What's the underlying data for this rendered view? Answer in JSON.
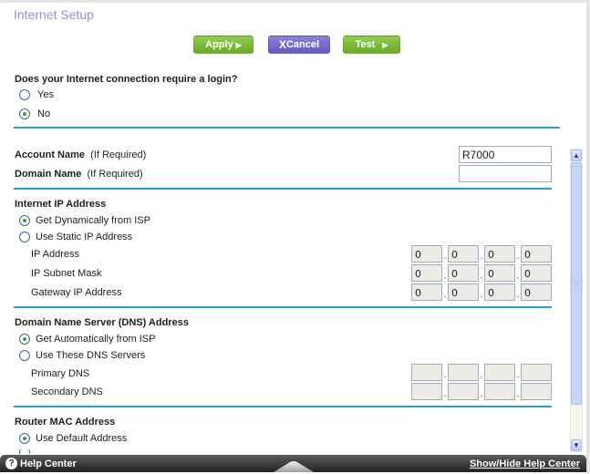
{
  "page": {
    "title": "Internet Setup"
  },
  "toolbar": {
    "apply_label": "Apply",
    "cancel_label": "Cancel",
    "test_label": "Test",
    "apply_color": "#7cbe3b",
    "cancel_color": "#7269cf"
  },
  "login": {
    "question": "Does your Internet connection require a login?",
    "options": [
      {
        "label": "Yes",
        "checked": false
      },
      {
        "label": "No",
        "checked": true
      }
    ]
  },
  "account": {
    "account_name_label": "Account Name",
    "account_name_hint": "(If Required)",
    "account_name_value": "R7000",
    "domain_name_label": "Domain Name",
    "domain_name_hint": "(If Required)",
    "domain_name_value": ""
  },
  "internet_ip": {
    "title": "Internet IP Address",
    "options": [
      {
        "label": "Get Dynamically from ISP",
        "checked": true
      },
      {
        "label": "Use Static IP Address",
        "checked": false
      }
    ],
    "fields": [
      {
        "label": "IP Address",
        "octets": [
          "0",
          "0",
          "0",
          "0"
        ]
      },
      {
        "label": "IP Subnet Mask",
        "octets": [
          "0",
          "0",
          "0",
          "0"
        ]
      },
      {
        "label": "Gateway IP Address",
        "octets": [
          "0",
          "0",
          "0",
          "0"
        ]
      }
    ]
  },
  "dns": {
    "title": "Domain Name Server (DNS) Address",
    "options": [
      {
        "label": "Get Automatically from ISP",
        "checked": true
      },
      {
        "label": "Use These DNS Servers",
        "checked": false
      }
    ],
    "fields": [
      {
        "label": "Primary DNS",
        "octets": [
          "",
          "",
          "",
          ""
        ]
      },
      {
        "label": "Secondary DNS",
        "octets": [
          "",
          "",
          "",
          ""
        ]
      }
    ]
  },
  "mac": {
    "title": "Router MAC Address",
    "options": [
      {
        "label": "Use Default Address",
        "checked": true
      }
    ]
  },
  "help_bar": {
    "left_label": "Help Center",
    "right_label": "Show/Hide Help Center"
  },
  "accent_color": "#2aa0d8"
}
